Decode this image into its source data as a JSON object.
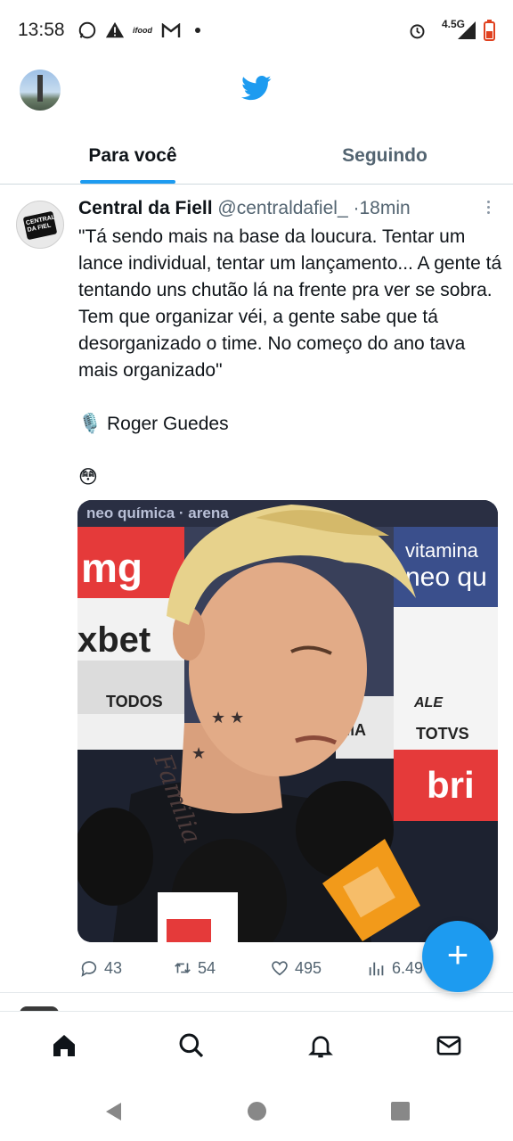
{
  "status_bar": {
    "time": "13:58",
    "network": "4.5G",
    "left_icons": [
      "whatsapp-icon",
      "alert-icon",
      "app-icon",
      "gmail-icon",
      "dot-icon"
    ],
    "right_icons": [
      "alarm-icon",
      "signal-icon",
      "battery-icon"
    ]
  },
  "header": {
    "logo": "twitter-bird-icon"
  },
  "tabs": [
    {
      "label": "Para você",
      "active": true
    },
    {
      "label": "Seguindo",
      "active": false
    }
  ],
  "tweet": {
    "author_name": "Central da Fiell",
    "handle": "@centraldafiel_",
    "separator": "·",
    "time": "18min",
    "avatar_text": "CENTRAL DA FIEL",
    "text": "\"Tá sendo mais na base da loucura. Tentar um lance individual, tentar um lançamento... A gente tá tentando uns chutão lá na frente pra ver se sobra. Tem que organizar véi, a gente sabe que tá desorganizado o time. No começo do ano tava mais organizado\"\n\n🎙️ Roger Guedes\n\n😳",
    "media_alt": "player interview photo",
    "media_backdrop_texts": [
      "neo química · arena",
      "mg",
      "vitamina",
      "neo qu",
      "xbet",
      "TODOS",
      "MA",
      "ALE",
      "TOTVS",
      "bri"
    ],
    "stats": {
      "replies": "43",
      "retweets": "54",
      "likes": "495",
      "views": "6.49"
    }
  },
  "fab": {
    "label": "+"
  },
  "bottom_nav": [
    "home-icon",
    "search-icon",
    "notifications-icon",
    "messages-icon"
  ],
  "colors": {
    "accent": "#1d9bf0",
    "text": "#0f1419",
    "muted": "#536471"
  }
}
